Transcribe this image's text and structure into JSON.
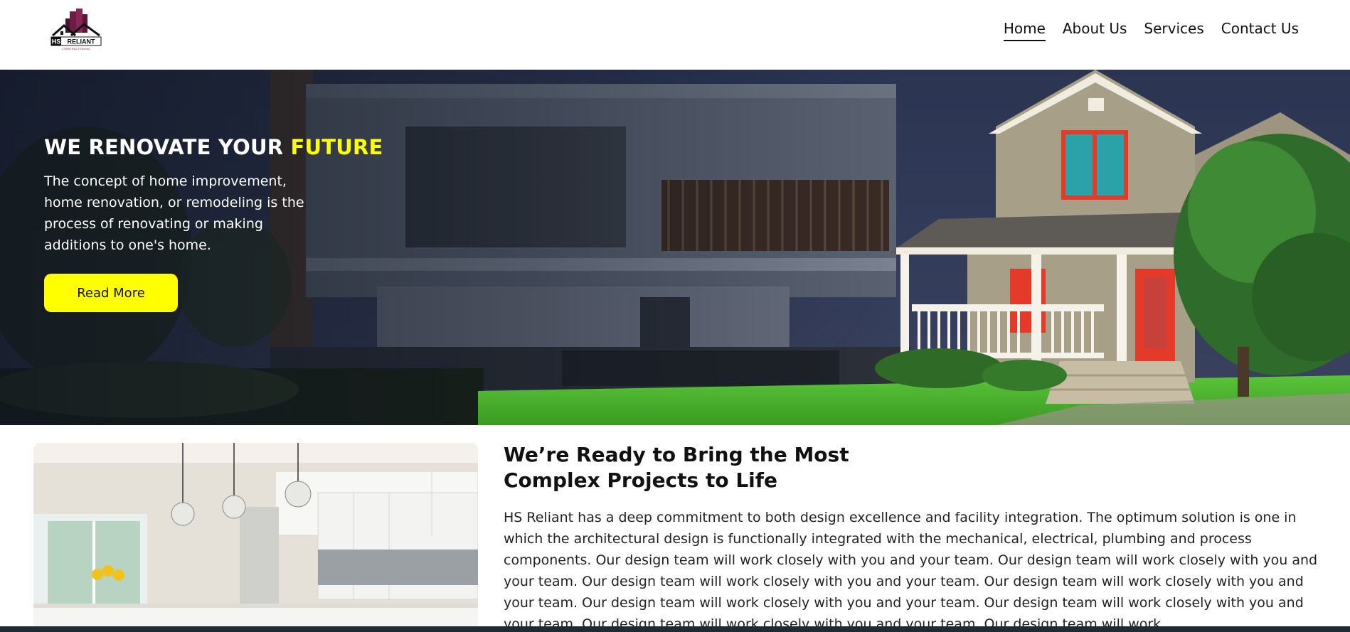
{
  "brand": {
    "name": "HS RELIANT",
    "tagline": "CONSTRUCTION INC"
  },
  "nav": {
    "items": [
      {
        "label": "Home",
        "active": true
      },
      {
        "label": "About Us",
        "active": false
      },
      {
        "label": "Services",
        "active": false
      },
      {
        "label": "Contact Us",
        "active": false
      }
    ]
  },
  "hero": {
    "title_main": "WE RENOVATE YOUR ",
    "title_accent": "FUTURE",
    "text": "The concept of home improvement, home renovation, or remodeling is the process of renovating or making additions to one's home.",
    "button_label": "Read More"
  },
  "about": {
    "title": "We’re Ready to Bring the Most Complex Projects to Life",
    "text": "HS Reliant has a deep commitment to both design excellence and facility integration. The optimum solution is one in which the architectural design is functionally integrated with the mechanical, electrical, plumbing and process components. Our design team will work closely with you and your team. Our design team will work closely with you and your team. Our design team will work closely with you and your team. Our design team will work closely with you and your team. Our design team will work closely with you and your team. Our design team will work closely with you and your team. Our design team will work closely with you and your team. Our design team will work"
  },
  "colors": {
    "accent": "#ffff00",
    "dark": "#111111",
    "brand_magenta": "#7a1a4a"
  }
}
